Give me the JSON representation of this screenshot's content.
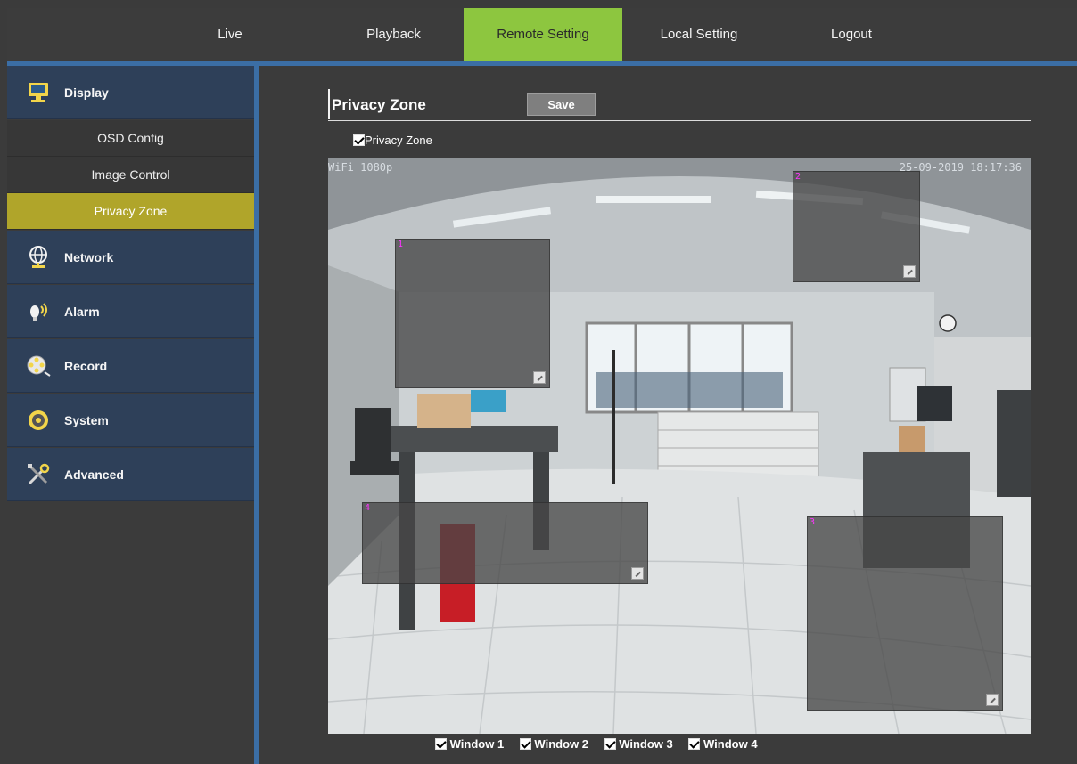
{
  "topnav": {
    "items": [
      {
        "label": "Live"
      },
      {
        "label": "Playback"
      },
      {
        "label": "Remote Setting"
      },
      {
        "label": "Local Setting"
      },
      {
        "label": "Logout"
      }
    ]
  },
  "sidebar": {
    "groups": [
      {
        "label": "Display",
        "icon": "monitor-icon"
      },
      {
        "label": "Network",
        "icon": "globe-icon"
      },
      {
        "label": "Alarm",
        "icon": "alarm-icon"
      },
      {
        "label": "Record",
        "icon": "film-reel-icon"
      },
      {
        "label": "System",
        "icon": "gear-icon"
      },
      {
        "label": "Advanced",
        "icon": "tools-icon"
      }
    ],
    "display_items": [
      {
        "label": "OSD Config"
      },
      {
        "label": "Image Control"
      },
      {
        "label": "Privacy Zone"
      }
    ],
    "active_item": "Privacy Zone"
  },
  "content": {
    "title": "Privacy Zone",
    "save_label": "Save",
    "enable_label": "Privacy Zone",
    "enable_checked": true
  },
  "video": {
    "osd_name": "WiFi 1080p",
    "osd_timestamp": "25-09-2019 18:17:36",
    "zones": [
      {
        "number": "1"
      },
      {
        "number": "2"
      },
      {
        "number": "3"
      },
      {
        "number": "4"
      }
    ]
  },
  "windows": [
    {
      "label": "Window 1",
      "checked": true
    },
    {
      "label": "Window 2",
      "checked": true
    },
    {
      "label": "Window 3",
      "checked": true
    },
    {
      "label": "Window 4",
      "checked": true
    }
  ],
  "colors": {
    "nav_active": "#8dc63f",
    "sidebar_group_bg": "#2e4059",
    "sidebar_active": "#b0a52a",
    "accent_line": "#3b6ea5"
  }
}
